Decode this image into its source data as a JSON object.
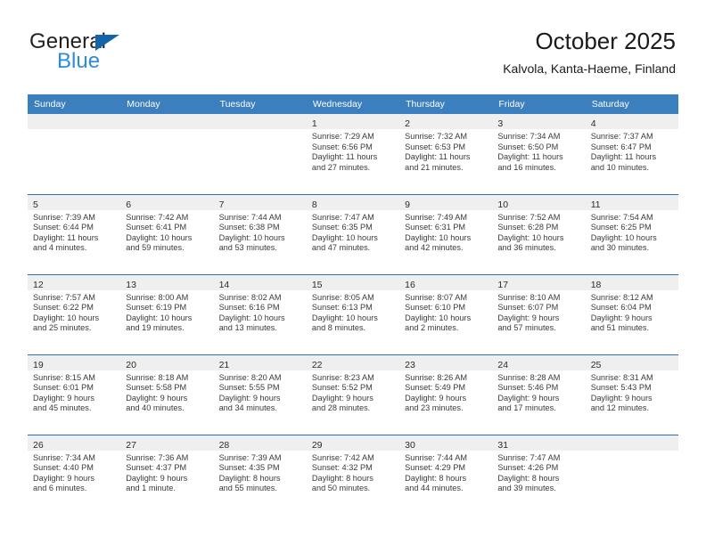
{
  "brand": {
    "name_part1": "General",
    "name_part2": "Blue",
    "triangle_icon": "blue-triangle-icon",
    "accent_color": "#1464aa",
    "blue_text_color": "#2e8bd6"
  },
  "header": {
    "title": "October 2025",
    "subtitle": "Kalvola, Kanta-Haeme, Finland"
  },
  "colors": {
    "header_row_background": "#3b7fbe",
    "header_row_text": "#ffffff",
    "day_band_background": "#efefef",
    "row_divider": "#2f6fab",
    "body_text": "#3a3a3a"
  },
  "calendar": {
    "weekday_headers": [
      "Sunday",
      "Monday",
      "Tuesday",
      "Wednesday",
      "Thursday",
      "Friday",
      "Saturday"
    ],
    "weeks": [
      [
        {
          "day": "",
          "lines": []
        },
        {
          "day": "",
          "lines": []
        },
        {
          "day": "",
          "lines": []
        },
        {
          "day": "1",
          "lines": [
            "Sunrise: 7:29 AM",
            "Sunset: 6:56 PM",
            "Daylight: 11 hours",
            "and 27 minutes."
          ]
        },
        {
          "day": "2",
          "lines": [
            "Sunrise: 7:32 AM",
            "Sunset: 6:53 PM",
            "Daylight: 11 hours",
            "and 21 minutes."
          ]
        },
        {
          "day": "3",
          "lines": [
            "Sunrise: 7:34 AM",
            "Sunset: 6:50 PM",
            "Daylight: 11 hours",
            "and 16 minutes."
          ]
        },
        {
          "day": "4",
          "lines": [
            "Sunrise: 7:37 AM",
            "Sunset: 6:47 PM",
            "Daylight: 11 hours",
            "and 10 minutes."
          ]
        }
      ],
      [
        {
          "day": "5",
          "lines": [
            "Sunrise: 7:39 AM",
            "Sunset: 6:44 PM",
            "Daylight: 11 hours",
            "and 4 minutes."
          ]
        },
        {
          "day": "6",
          "lines": [
            "Sunrise: 7:42 AM",
            "Sunset: 6:41 PM",
            "Daylight: 10 hours",
            "and 59 minutes."
          ]
        },
        {
          "day": "7",
          "lines": [
            "Sunrise: 7:44 AM",
            "Sunset: 6:38 PM",
            "Daylight: 10 hours",
            "and 53 minutes."
          ]
        },
        {
          "day": "8",
          "lines": [
            "Sunrise: 7:47 AM",
            "Sunset: 6:35 PM",
            "Daylight: 10 hours",
            "and 47 minutes."
          ]
        },
        {
          "day": "9",
          "lines": [
            "Sunrise: 7:49 AM",
            "Sunset: 6:31 PM",
            "Daylight: 10 hours",
            "and 42 minutes."
          ]
        },
        {
          "day": "10",
          "lines": [
            "Sunrise: 7:52 AM",
            "Sunset: 6:28 PM",
            "Daylight: 10 hours",
            "and 36 minutes."
          ]
        },
        {
          "day": "11",
          "lines": [
            "Sunrise: 7:54 AM",
            "Sunset: 6:25 PM",
            "Daylight: 10 hours",
            "and 30 minutes."
          ]
        }
      ],
      [
        {
          "day": "12",
          "lines": [
            "Sunrise: 7:57 AM",
            "Sunset: 6:22 PM",
            "Daylight: 10 hours",
            "and 25 minutes."
          ]
        },
        {
          "day": "13",
          "lines": [
            "Sunrise: 8:00 AM",
            "Sunset: 6:19 PM",
            "Daylight: 10 hours",
            "and 19 minutes."
          ]
        },
        {
          "day": "14",
          "lines": [
            "Sunrise: 8:02 AM",
            "Sunset: 6:16 PM",
            "Daylight: 10 hours",
            "and 13 minutes."
          ]
        },
        {
          "day": "15",
          "lines": [
            "Sunrise: 8:05 AM",
            "Sunset: 6:13 PM",
            "Daylight: 10 hours",
            "and 8 minutes."
          ]
        },
        {
          "day": "16",
          "lines": [
            "Sunrise: 8:07 AM",
            "Sunset: 6:10 PM",
            "Daylight: 10 hours",
            "and 2 minutes."
          ]
        },
        {
          "day": "17",
          "lines": [
            "Sunrise: 8:10 AM",
            "Sunset: 6:07 PM",
            "Daylight: 9 hours",
            "and 57 minutes."
          ]
        },
        {
          "day": "18",
          "lines": [
            "Sunrise: 8:12 AM",
            "Sunset: 6:04 PM",
            "Daylight: 9 hours",
            "and 51 minutes."
          ]
        }
      ],
      [
        {
          "day": "19",
          "lines": [
            "Sunrise: 8:15 AM",
            "Sunset: 6:01 PM",
            "Daylight: 9 hours",
            "and 45 minutes."
          ]
        },
        {
          "day": "20",
          "lines": [
            "Sunrise: 8:18 AM",
            "Sunset: 5:58 PM",
            "Daylight: 9 hours",
            "and 40 minutes."
          ]
        },
        {
          "day": "21",
          "lines": [
            "Sunrise: 8:20 AM",
            "Sunset: 5:55 PM",
            "Daylight: 9 hours",
            "and 34 minutes."
          ]
        },
        {
          "day": "22",
          "lines": [
            "Sunrise: 8:23 AM",
            "Sunset: 5:52 PM",
            "Daylight: 9 hours",
            "and 28 minutes."
          ]
        },
        {
          "day": "23",
          "lines": [
            "Sunrise: 8:26 AM",
            "Sunset: 5:49 PM",
            "Daylight: 9 hours",
            "and 23 minutes."
          ]
        },
        {
          "day": "24",
          "lines": [
            "Sunrise: 8:28 AM",
            "Sunset: 5:46 PM",
            "Daylight: 9 hours",
            "and 17 minutes."
          ]
        },
        {
          "day": "25",
          "lines": [
            "Sunrise: 8:31 AM",
            "Sunset: 5:43 PM",
            "Daylight: 9 hours",
            "and 12 minutes."
          ]
        }
      ],
      [
        {
          "day": "26",
          "lines": [
            "Sunrise: 7:34 AM",
            "Sunset: 4:40 PM",
            "Daylight: 9 hours",
            "and 6 minutes."
          ]
        },
        {
          "day": "27",
          "lines": [
            "Sunrise: 7:36 AM",
            "Sunset: 4:37 PM",
            "Daylight: 9 hours",
            "and 1 minute."
          ]
        },
        {
          "day": "28",
          "lines": [
            "Sunrise: 7:39 AM",
            "Sunset: 4:35 PM",
            "Daylight: 8 hours",
            "and 55 minutes."
          ]
        },
        {
          "day": "29",
          "lines": [
            "Sunrise: 7:42 AM",
            "Sunset: 4:32 PM",
            "Daylight: 8 hours",
            "and 50 minutes."
          ]
        },
        {
          "day": "30",
          "lines": [
            "Sunrise: 7:44 AM",
            "Sunset: 4:29 PM",
            "Daylight: 8 hours",
            "and 44 minutes."
          ]
        },
        {
          "day": "31",
          "lines": [
            "Sunrise: 7:47 AM",
            "Sunset: 4:26 PM",
            "Daylight: 8 hours",
            "and 39 minutes."
          ]
        },
        {
          "day": "",
          "lines": []
        }
      ]
    ]
  }
}
